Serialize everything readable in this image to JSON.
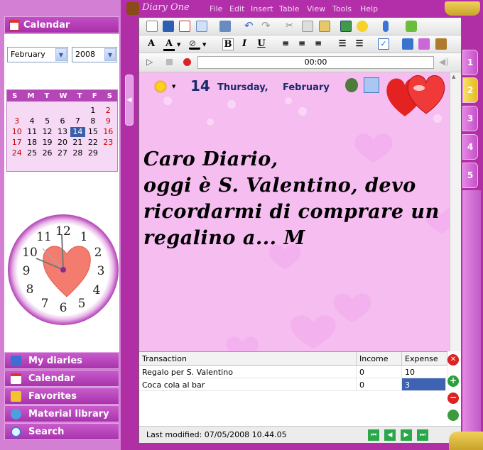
{
  "app": {
    "title": "Diary One"
  },
  "menu": [
    "File",
    "Edit",
    "Insert",
    "Table",
    "View",
    "Tools",
    "Help"
  ],
  "sidebar": {
    "calendar_header": "Calendar",
    "month_select": "February",
    "year_select": "2008",
    "weekdays": [
      "S",
      "M",
      "T",
      "W",
      "T",
      "F",
      "S"
    ],
    "days": [
      [
        "",
        "",
        "",
        "",
        "",
        "1",
        "2"
      ],
      [
        "3",
        "4",
        "5",
        "6",
        "7",
        "8",
        "9"
      ],
      [
        "10",
        "11",
        "12",
        "13",
        "14",
        "15",
        "16"
      ],
      [
        "17",
        "18",
        "19",
        "20",
        "21",
        "22",
        "23"
      ],
      [
        "24",
        "25",
        "26",
        "27",
        "28",
        "29",
        ""
      ]
    ],
    "today": "14",
    "clock_numbers": [
      "12",
      "1",
      "2",
      "3",
      "4",
      "5",
      "6",
      "7",
      "8",
      "9",
      "10",
      "11"
    ],
    "nav": [
      {
        "label": "My diaries",
        "icon": "diary-icon"
      },
      {
        "label": "Calendar",
        "icon": "calendar-icon"
      },
      {
        "label": "Favorites",
        "icon": "favorites-icon"
      },
      {
        "label": "Material library",
        "icon": "film-icon"
      },
      {
        "label": "Search",
        "icon": "search-icon"
      }
    ]
  },
  "media": {
    "time": "00:00"
  },
  "page": {
    "day": "14",
    "weekday": "Thursday,",
    "month": "February",
    "tabs": [
      "1",
      "2",
      "3",
      "4",
      "5"
    ],
    "active_tab": "2",
    "text_lines": [
      "Caro Diario,",
      "oggi è S. Valentino, devo",
      "ricordarmi di comprare un",
      "regalino a... M"
    ]
  },
  "expenses": {
    "headers": [
      "Transaction",
      "Income",
      "Expense"
    ],
    "rows": [
      [
        "Regalo per S. Valentino",
        "0",
        "10"
      ],
      [
        "Coca cola al bar",
        "0",
        "3"
      ]
    ]
  },
  "status": {
    "last_modified": "Last modified: 07/05/2008 10.44.05"
  },
  "colors": {
    "sidebar_bg": "#d37fd4",
    "frame": "#b02fa4",
    "page_bg": "#f6bdf1",
    "accent": "#a933ad"
  }
}
